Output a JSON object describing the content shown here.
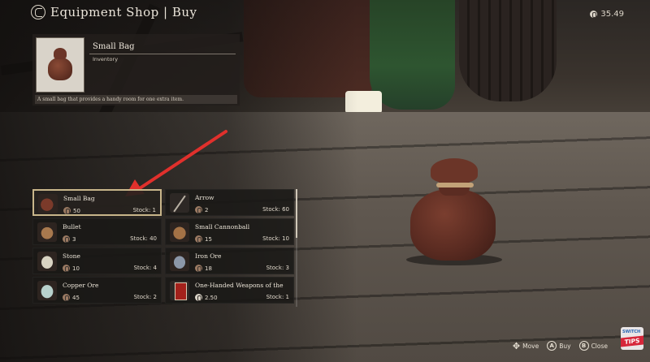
{
  "header": {
    "title": "Equipment Shop | Buy",
    "icon": "shop-icon"
  },
  "currency": {
    "amount": "35.49",
    "icon": "coin-icon"
  },
  "detail": {
    "name": "Small Bag",
    "category": "Inventory",
    "description": "A small bag that provides a handy room for one extra item.",
    "image_icon": "small-bag-icon"
  },
  "items": [
    {
      "name": "Small Bag",
      "price": "50",
      "stock": "Stock: 1",
      "icon": "small-bag-icon",
      "coin": "bronze",
      "selected": true
    },
    {
      "name": "Arrow",
      "price": "2",
      "stock": "Stock: 60",
      "icon": "arrow-icon",
      "coin": "bronze",
      "selected": false
    },
    {
      "name": "Bullet",
      "price": "3",
      "stock": "Stock: 40",
      "icon": "bullet-pouch-icon",
      "coin": "bronze",
      "selected": false
    },
    {
      "name": "Small Cannonball",
      "price": "15",
      "stock": "Stock: 10",
      "icon": "cannonball-pouch-icon",
      "coin": "bronze",
      "selected": false
    },
    {
      "name": "Stone",
      "price": "10",
      "stock": "Stock: 4",
      "icon": "stone-icon",
      "coin": "bronze",
      "selected": false
    },
    {
      "name": "Iron Ore",
      "price": "18",
      "stock": "Stock: 3",
      "icon": "iron-ore-icon",
      "coin": "bronze",
      "selected": false
    },
    {
      "name": "Copper Ore",
      "price": "45",
      "stock": "Stock: 2",
      "icon": "copper-ore-icon",
      "coin": "bronze",
      "selected": false
    },
    {
      "name": "One-Handed Weapons of the",
      "price": "2.50",
      "stock": "Stock: 1",
      "icon": "book-icon",
      "coin": "silver",
      "selected": false
    }
  ],
  "controls": {
    "move": "Move",
    "buy_key": "A",
    "buy": "Buy",
    "close_key": "B",
    "close": "Close"
  },
  "logo": {
    "top": "SWITCH",
    "band": "TIPS"
  },
  "colors": {
    "selection_border": "#c8b58a",
    "arrow": "#e0302c"
  }
}
